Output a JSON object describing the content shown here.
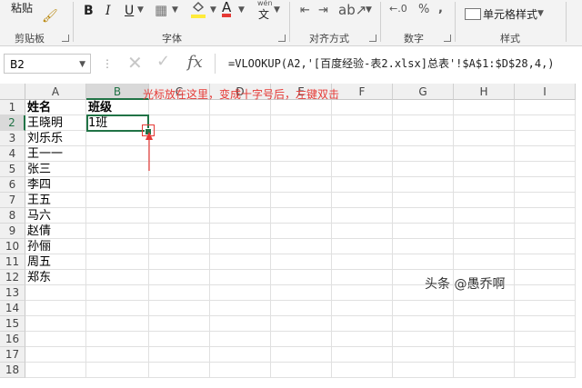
{
  "ribbon": {
    "paste_label": "粘贴",
    "groups": [
      {
        "label": "剪贴板"
      },
      {
        "label": "字体"
      },
      {
        "label": "对齐方式"
      },
      {
        "label": "数字"
      },
      {
        "label": "样式"
      }
    ],
    "font_bold": "B",
    "font_italic": "I",
    "font_underline": "U",
    "wen_label": "wén",
    "wen_char": "文",
    "percent": "%",
    "comma": ",",
    "cell_style": "单元格样式",
    "zoom_note": ""
  },
  "formula_bar": {
    "name_box": "B2",
    "formula": "=VLOOKUP(A2,'[百度经验-表2.xlsx]总表'!$A$1:$D$28,4,)"
  },
  "columns": [
    "A",
    "B",
    "C",
    "D",
    "E",
    "F",
    "G",
    "H",
    "I"
  ],
  "rows": [
    "1",
    "2",
    "3",
    "4",
    "5",
    "6",
    "7",
    "8",
    "9",
    "10",
    "11",
    "12",
    "13",
    "14",
    "15",
    "16",
    "17",
    "18"
  ],
  "cells": {
    "A1": "姓名",
    "B1": "班级",
    "A2": "王晓明",
    "B2": "1班",
    "A3": "刘乐乐",
    "A4": "王一一",
    "A5": "张三",
    "A6": "李四",
    "A7": "王五",
    "A8": "马六",
    "A9": "赵倩",
    "A10": "孙俪",
    "A11": "周五",
    "A12": "郑东"
  },
  "annotation": "光标放在这里，变成十字号后，左键双击",
  "watermark": "头条 @愚乔啊",
  "colors": {
    "accent": "#217346",
    "annotation": "#e53935"
  }
}
